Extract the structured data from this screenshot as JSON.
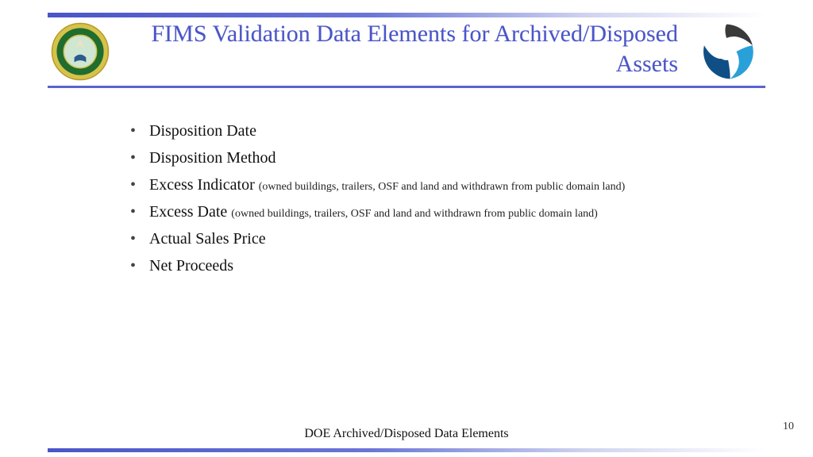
{
  "header": {
    "title": "FIMS Validation Data Elements for Archived/Disposed Assets"
  },
  "bullets": [
    {
      "label": "Disposition Date",
      "sub": ""
    },
    {
      "label": "Disposition Method",
      "sub": ""
    },
    {
      "label": "Excess Indicator",
      "sub": "(owned buildings, trailers, OSF and land and withdrawn from public domain land)"
    },
    {
      "label": "Excess Date",
      "sub": "(owned buildings, trailers, OSF and land and withdrawn from public domain land)"
    },
    {
      "label": "Actual Sales Price",
      "sub": ""
    },
    {
      "label": "Net Proceeds",
      "sub": ""
    }
  ],
  "footer": {
    "text": "DOE Archived/Disposed Data Elements",
    "page": "10"
  },
  "colors": {
    "accent": "#4a55c8"
  }
}
